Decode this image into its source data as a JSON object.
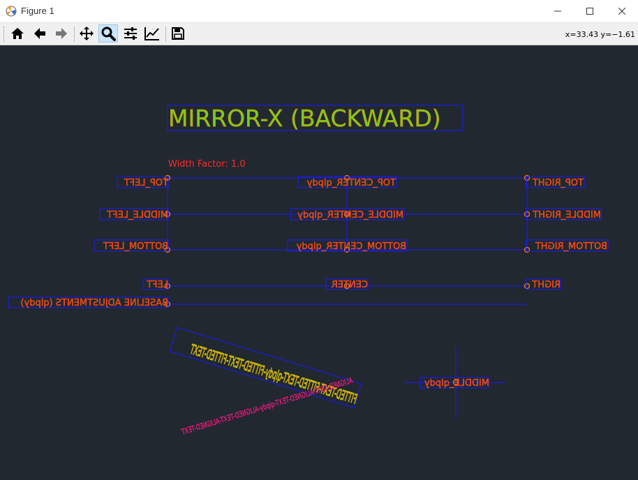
{
  "window": {
    "title": "Figure 1"
  },
  "toolbar": {
    "coords": "x=33.43 y=−1.61",
    "buttons": [
      "home-icon",
      "back-arrow-icon",
      "forward-arrow-icon",
      "pan-icon",
      "zoom-icon",
      "configure-subplots-icon",
      "edit-axis-icon",
      "save-icon"
    ]
  },
  "plot": {
    "title": "MIRROR-X (BACKWARD)",
    "width_factor": "Width Factor: 1.0",
    "labels": {
      "top_left": "TOP_LEFT",
      "top_center": "TOP_CENTER_qlpdy",
      "top_right": "TOP_RIGHT",
      "middle_left": "MIDDLE_LEFT",
      "middle_center": "MIDDLE_CENTER_qlpdy",
      "middle_right": "MIDDLE_RIGHT",
      "bottom_left": "BOTTOM_LEFT",
      "bottom_center": "BOTTOM_CENTER_qlpdy",
      "bottom_right": "BOTTOM_RIGHT",
      "left": "LEFT",
      "center": "CENTER",
      "right": "RIGHT",
      "baseline": "BASELINE ADJUSTMENTS (qlpdy)",
      "fitted": "FITTED-TEXT-FITTED-TEXT-qlpdy-FITTED-TEXT-FITTED-TEXT",
      "aligned": "ALIGNED-TEXT-ALIGNED-TEXT-qlpdy-ALIGNED-TEXT-ALIGNED-TEXT",
      "middle": "MIDDLE_qlpdy"
    },
    "colors": {
      "text": "#ff2a2a",
      "box": "#1a1aff",
      "anchor": "#ff8000",
      "title": "#6fd21a",
      "background": "#212830"
    }
  }
}
